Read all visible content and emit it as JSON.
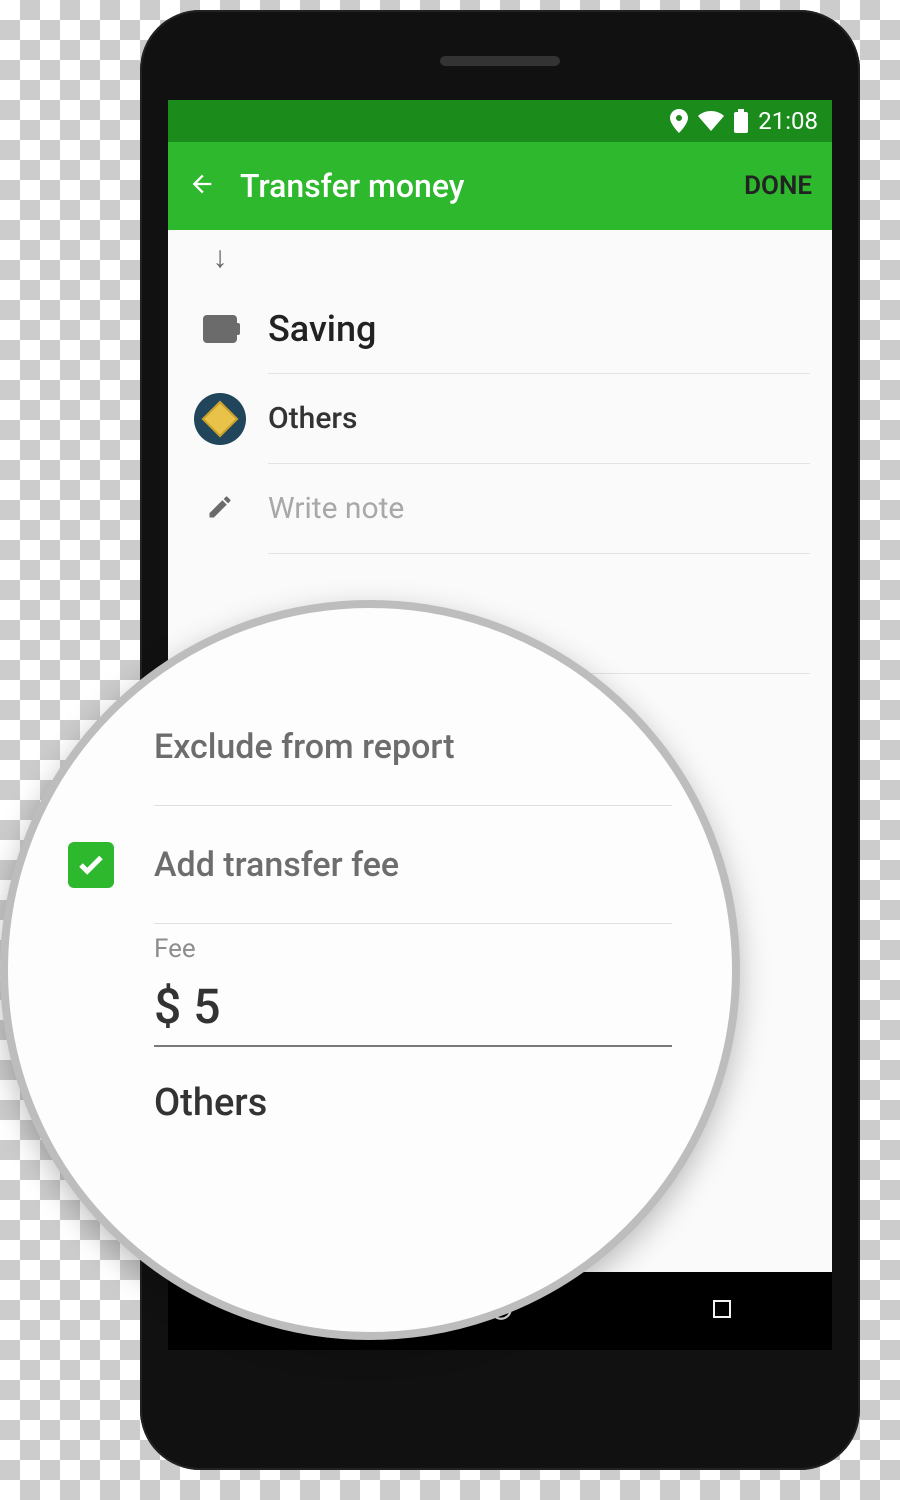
{
  "status": {
    "time": "21:08"
  },
  "appbar": {
    "title": "Transfer money",
    "done": "DONE"
  },
  "form": {
    "wallet": "Saving",
    "category": "Others",
    "note_placeholder": "Write note"
  },
  "magnifier": {
    "exclude_label": "Exclude from report",
    "add_fee_label": "Add transfer fee",
    "fee_caption": "Fee",
    "fee_value": "$ 5",
    "others_label": "Others"
  }
}
